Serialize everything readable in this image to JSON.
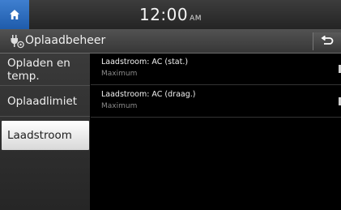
{
  "status_bar": {
    "time": "12:00",
    "ampm": "AM",
    "home_icon": "home-icon"
  },
  "title_bar": {
    "title": "Oplaadbeheer",
    "icon": "charging-plug-icon",
    "back_icon": "back-arrow-icon"
  },
  "sidebar": {
    "items": [
      {
        "label_line1": "Opladen en",
        "label_line2": "temp.",
        "selected": false
      },
      {
        "label": "Oplaadlimiet",
        "selected": false
      },
      {
        "label": "Laadstroom",
        "selected": true
      }
    ]
  },
  "main": {
    "rows": [
      {
        "title": "Laadstroom: AC (stat.)",
        "value": "Maximum"
      },
      {
        "title": "Laadstroom: AC (draag.)",
        "value": "Maximum"
      }
    ]
  },
  "colors": {
    "accent": "#2f6fc2",
    "selected_bg": "#f2f2f2",
    "background": "#000000"
  }
}
